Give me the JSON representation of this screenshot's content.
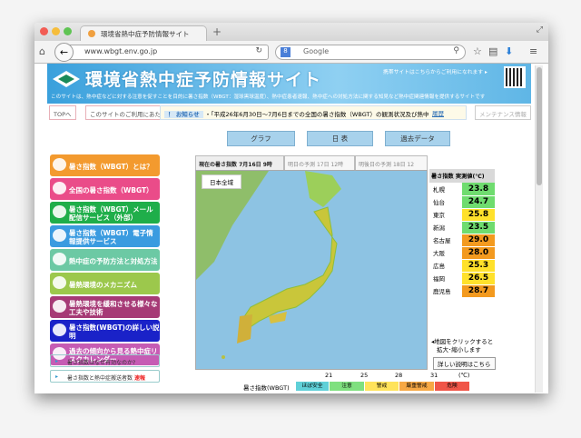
{
  "browser": {
    "tab_title": "環境省熱中症予防情報サイト",
    "url": "www.wbgt.env.go.jp",
    "search_placeholder": "Google",
    "new_tab": "+"
  },
  "banner": {
    "title": "環境省熱中症予防情報サイト",
    "subtitle": "このサイトは、熱中症などに対する注意を促すことを目的に暑さ指数（WBGT：湿球黒球温度）、熱中症患者速報、熱中症への対処方法に関する知見など熱中症関連情報を提供するサイトです",
    "mobile": "携帯サイトはこちらからご利用になれます ▸"
  },
  "nav": {
    "top": "TOPへ",
    "usage": "このサイトのご利用にあたって",
    "notice_label": "！ お知らせ",
    "notice_text": "・「平成26年6月30日～7月6日までの全国の暑さ指数（WBGT）の観測状況及び熱中",
    "history": "履歴",
    "maintenance": "メンテナンス情報"
  },
  "menu": [
    {
      "label": "暑さ指数（WBGT）とは？",
      "color": "#f39a2e"
    },
    {
      "label": "全国の暑さ指数（WBGT）",
      "color": "#ea4c89"
    },
    {
      "label": "暑さ指数（WBGT）メール配信サービス（外部）",
      "color": "#1fae4a"
    },
    {
      "label": "暑さ指数（WBGT）電子情報提供サービス",
      "color": "#3a9be0"
    },
    {
      "label": "熱中症の予防方法と対処方法",
      "color": "#6cc9a4"
    },
    {
      "label": "暑熱環境のメカニズム",
      "color": "#9cc84c"
    },
    {
      "label": "暑熱環境を緩和させる様々な工夫や技術",
      "color": "#a63a76"
    },
    {
      "label": "暑さ指数(WBGT)の詳しい説明",
      "color": "#1a22c8"
    },
    {
      "label": "過去の傾向から見る熱中症リスクカレンダー",
      "color": "#c65cb4"
    }
  ],
  "side_links": [
    {
      "label": "暑さ指数はなぜ有効なのか?"
    },
    {
      "label": "暑さ指数と熱中症搬送者数",
      "badge": "速報"
    }
  ],
  "views": [
    "グラフ",
    "日 表",
    "過去データ"
  ],
  "map_tabs": [
    {
      "label": "現在の暑さ指数",
      "time": "7月16日 9時",
      "active": true
    },
    {
      "label": "明日の予測",
      "time": "17日 12時"
    },
    {
      "label": "明後日の予測",
      "time": "18日 12"
    }
  ],
  "map": {
    "region": "日本全域"
  },
  "obs_table": {
    "header": "暑さ指数 実測値(℃)",
    "rows": [
      {
        "city": "札幌",
        "value": "23.8",
        "color": "#6fdc6f"
      },
      {
        "city": "仙台",
        "value": "24.7",
        "color": "#6fdc6f"
      },
      {
        "city": "東京",
        "value": "25.8",
        "color": "#ffe12b"
      },
      {
        "city": "新潟",
        "value": "23.5",
        "color": "#6fdc6f"
      },
      {
        "city": "名古屋",
        "value": "29.0",
        "color": "#f39a1f"
      },
      {
        "city": "大阪",
        "value": "28.0",
        "color": "#f39a1f"
      },
      {
        "city": "広島",
        "value": "25.3",
        "color": "#ffe12b"
      },
      {
        "city": "福岡",
        "value": "26.5",
        "color": "#ffe12b"
      },
      {
        "city": "鹿児島",
        "value": "28.7",
        "color": "#f39a1f"
      }
    ]
  },
  "map_note": {
    "text1": "◂地図をクリックすると",
    "text2": "拡大･縮小します",
    "detail": "詳しい説明はこちら"
  },
  "legend": {
    "label": "暑さ指数(WBGT)",
    "ticks": [
      "21",
      "25",
      "28",
      "31",
      "(℃)"
    ],
    "levels": [
      {
        "name": "ほぼ安全",
        "color": "#5fd0d8"
      },
      {
        "name": "注意",
        "color": "#7fe07f"
      },
      {
        "name": "警戒",
        "color": "#ffe35a"
      },
      {
        "name": "厳重警戒",
        "color": "#f7a844"
      },
      {
        "name": "危険",
        "color": "#f05548"
      }
    ]
  }
}
